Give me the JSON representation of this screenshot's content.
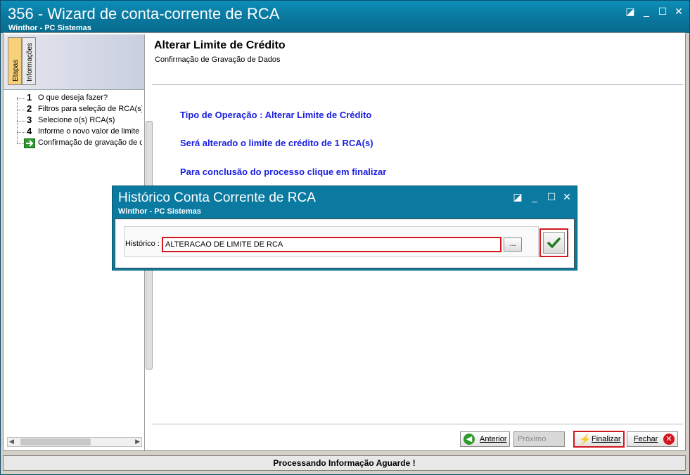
{
  "window": {
    "title": "356 - Wizard de conta-corrente de RCA",
    "subtitle": "Winthor - PC Sistemas",
    "controls": {
      "restore": "◪",
      "minimize": "_",
      "maximize": "☐",
      "close": "✕"
    }
  },
  "sidebar": {
    "tabs": [
      {
        "label": "Etapas"
      },
      {
        "label": "Informações"
      }
    ],
    "steps": [
      {
        "num": "1",
        "label": "O que deseja fazer?"
      },
      {
        "num": "2",
        "label": "Filtros para seleção de RCA(s)"
      },
      {
        "num": "3",
        "label": "Selecione o(s) RCA(s)"
      },
      {
        "num": "4",
        "label": "Informe o novo valor de limite"
      },
      {
        "num": "",
        "label": "Confirmação de gravação de d",
        "current_icon": "arrow-right-icon"
      }
    ],
    "scroll_left": "◀",
    "scroll_right": "▶"
  },
  "main": {
    "title": "Alterar Limite de Crédito",
    "subtitle": "Confirmação de Gravação de Dados",
    "lines": [
      "Tipo de Operação : Alterar Limite de Crédito",
      "Será alterado o limite de crédito de 1 RCA(s)",
      "Para conclusão do processo clique em finalizar"
    ]
  },
  "buttons": {
    "anterior": "Anterior",
    "proximo": "Próximo",
    "finalizar": "Finalizar",
    "fechar": "Fechar"
  },
  "status": "Processando Informação Aguarde !",
  "dialog": {
    "title": "Histórico Conta Corrente de RCA",
    "subtitle": "Winthor - PC Sistemas",
    "historico_label": "Histórico :",
    "historico_value": "ALTERACAO DE LIMITE DE RCA",
    "ellipsis": "...",
    "confirm_icon": "checkmark-icon"
  },
  "colors": {
    "titlebar": "#0a7aa1",
    "highlight": "#d4161f",
    "blue_text": "#1a1ee0"
  }
}
